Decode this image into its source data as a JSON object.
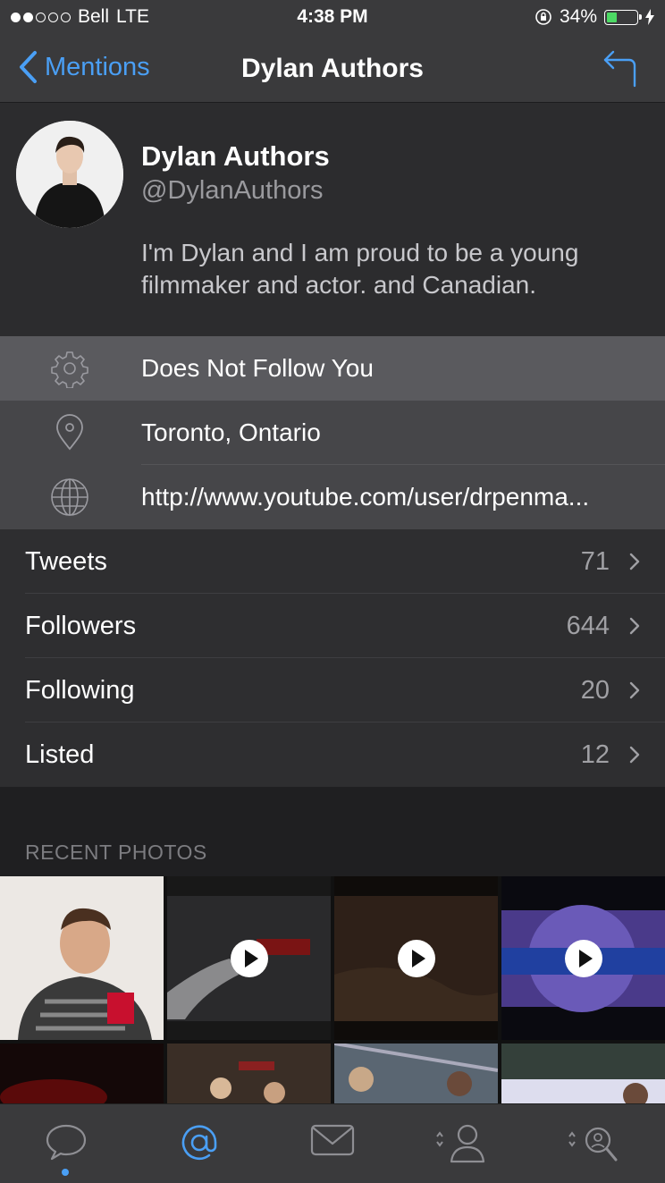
{
  "status_bar": {
    "carrier": "Bell",
    "network": "LTE",
    "time": "4:38 PM",
    "battery": "34%",
    "battery_level": 0.34
  },
  "nav": {
    "back_label": "Mentions",
    "title": "Dylan Authors",
    "reply_icon": "reply-arrow-icon"
  },
  "profile": {
    "name": "Dylan Authors",
    "handle": "@DylanAuthors",
    "bio": "I'm Dylan and I am proud to be a young filmmaker and actor. and Canadian."
  },
  "info_rows": {
    "follow_status": "Does Not Follow You",
    "location": "Toronto, Ontario",
    "url": "http://www.youtube.com/user/drpenma..."
  },
  "stats": [
    {
      "label": "Tweets",
      "count": "71"
    },
    {
      "label": "Followers",
      "count": "644"
    },
    {
      "label": "Following",
      "count": "20"
    },
    {
      "label": "Listed",
      "count": "12"
    }
  ],
  "photos_header": "RECENT PHOTOS",
  "tabs": [
    "timeline-icon",
    "mentions-icon",
    "messages-icon",
    "profile-icon",
    "search-icon"
  ],
  "colors": {
    "accent": "#4a9ff5",
    "background": "#2b2b2d",
    "battery_fill": "#4cd964"
  }
}
